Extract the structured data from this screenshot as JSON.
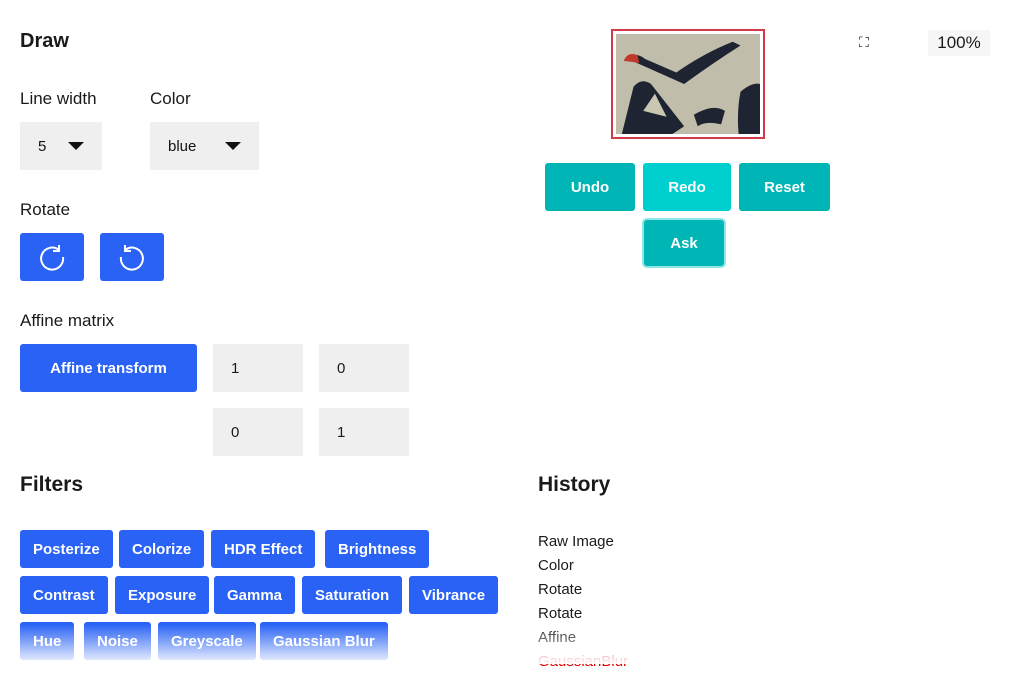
{
  "draw": {
    "title": "Draw",
    "line_width_label": "Line width",
    "line_width_value": "5",
    "color_label": "Color",
    "color_value": "blue"
  },
  "rotate": {
    "title": "Rotate",
    "cw_icon": "rotate-clockwise-icon",
    "ccw_icon": "rotate-counterclockwise-icon"
  },
  "affine": {
    "title": "Affine matrix",
    "button_label": "Affine transform",
    "matrix": [
      "1",
      "0",
      "0",
      "1"
    ]
  },
  "preview": {
    "zoom": "100%",
    "fullscreen_icon": "fullscreen-icon",
    "border_color": "#d33b4a"
  },
  "actions": {
    "undo": "Undo",
    "redo": "Redo",
    "reset": "Reset",
    "ask": "Ask"
  },
  "filters": {
    "title": "Filters",
    "items": [
      "Posterize",
      "Colorize",
      "HDR Effect",
      "Brightness",
      "Contrast",
      "Exposure",
      "Gamma",
      "Saturation",
      "Vibrance",
      "Hue",
      "Noise",
      "Greyscale",
      "Gaussian Blur"
    ]
  },
  "history": {
    "title": "History",
    "items": [
      "Raw Image",
      "Color",
      "Rotate",
      "Rotate",
      "Affine",
      "GaussianBlur"
    ],
    "active_index": 5
  },
  "colors": {
    "primary_blue": "#2962f5",
    "teal": "#00b5b5",
    "teal_light": "#00cfcf",
    "history_active": "#e00000"
  }
}
